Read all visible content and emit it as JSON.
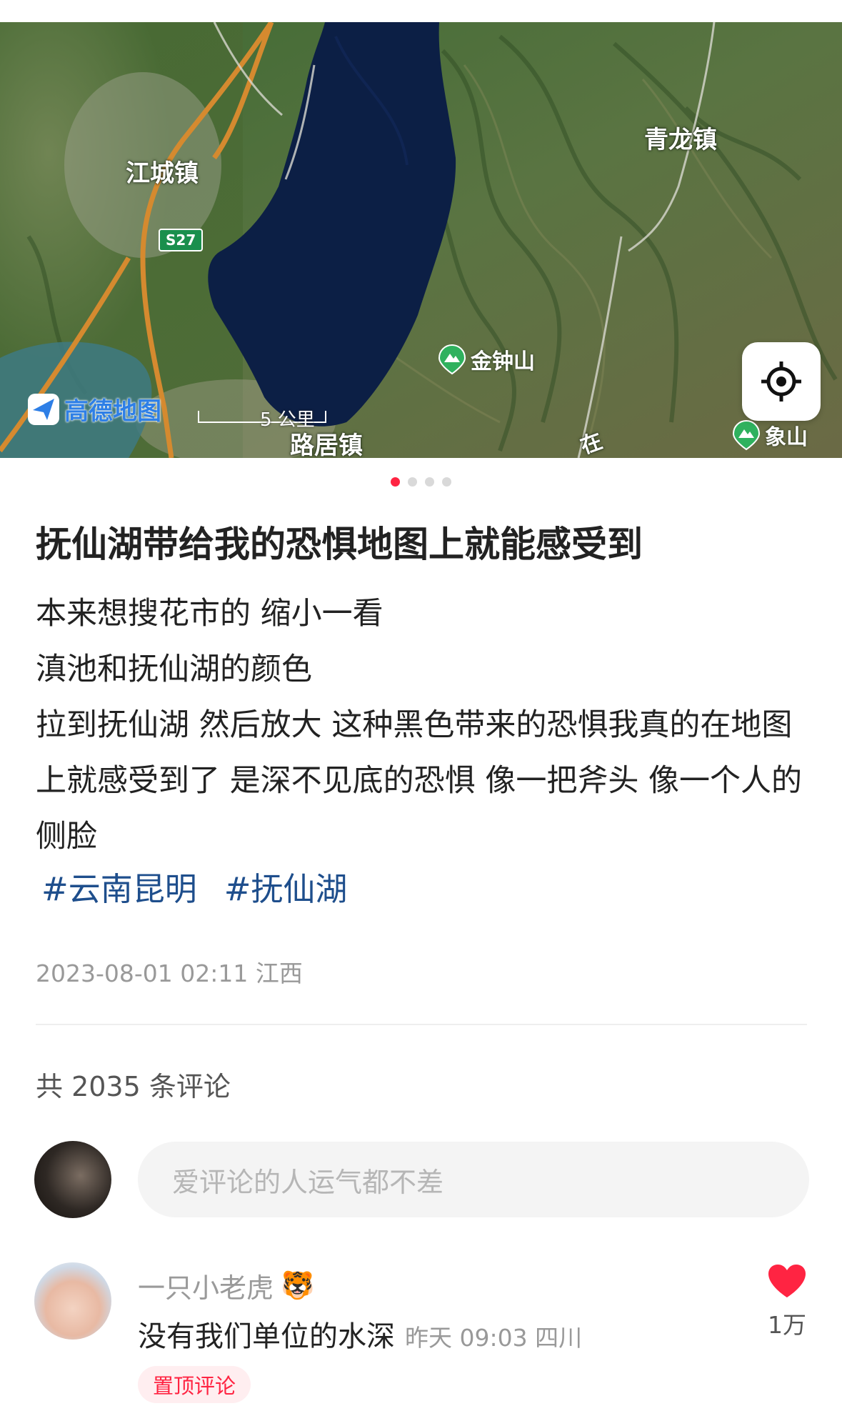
{
  "map": {
    "places": {
      "jiangcheng": "江城镇",
      "qinglong": "青龙镇",
      "luju": "路居镇",
      "jinzhongshan": "金钟山",
      "xiangshan": "象山",
      "zai": "在"
    },
    "road": "S27",
    "scale": "5 公里",
    "brand": "高德地图",
    "locate_icon": "locate-crosshair-icon"
  },
  "carousel": {
    "total": 4,
    "active": 1
  },
  "post": {
    "title": "抚仙湖带给我的恐惧地图上就能感受到",
    "lines": [
      "本来想搜花市的 缩小一看",
      "滇池和抚仙湖的颜色",
      "拉到抚仙湖 然后放大 这种黑色带来的恐惧我真的在地图上就感受到了 是深不见底的恐惧 像一把斧头 像一个人的侧脸"
    ],
    "tags": [
      "#云南昆明",
      "#抚仙湖"
    ],
    "meta": "2023-08-01 02:11 江西"
  },
  "comments": {
    "count_text": "共 2035 条评论",
    "input_placeholder": "爱评论的人运气都不差",
    "items": [
      {
        "name": "一只小老虎",
        "emoji": "🐯",
        "text": "没有我们单位的水深",
        "time": "昨天 09:03 四川",
        "badge": "置顶评论",
        "likes": "1万"
      }
    ]
  },
  "colors": {
    "accent": "#ff2442",
    "tag": "#1e4e8c",
    "lake": "#0c1f45"
  }
}
